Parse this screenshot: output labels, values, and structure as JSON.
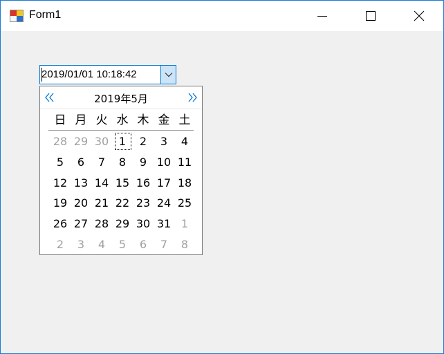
{
  "window": {
    "title": "Form1",
    "frame_color": "#1b7bd6",
    "icons": [
      "app-form-icon",
      "minimize-icon",
      "maximize-icon",
      "close-icon"
    ]
  },
  "date_picker": {
    "value": "2019/01/01 10:18:42",
    "dropdown_icon": "chevron-down-icon"
  },
  "calendar": {
    "title": "2019年5月",
    "prev_icon": "double-chevron-left-icon",
    "next_icon": "double-chevron-right-icon",
    "weekdays": [
      "日",
      "月",
      "火",
      "水",
      "木",
      "金",
      "土"
    ],
    "selected_day": "1",
    "weeks": [
      [
        {
          "d": "28",
          "o": true
        },
        {
          "d": "29",
          "o": true
        },
        {
          "d": "30",
          "o": true
        },
        {
          "d": "1",
          "o": false,
          "f": true
        },
        {
          "d": "2",
          "o": false
        },
        {
          "d": "3",
          "o": false
        },
        {
          "d": "4",
          "o": false
        }
      ],
      [
        {
          "d": "5",
          "o": false
        },
        {
          "d": "6",
          "o": false
        },
        {
          "d": "7",
          "o": false
        },
        {
          "d": "8",
          "o": false
        },
        {
          "d": "9",
          "o": false
        },
        {
          "d": "10",
          "o": false
        },
        {
          "d": "11",
          "o": false
        }
      ],
      [
        {
          "d": "12",
          "o": false
        },
        {
          "d": "13",
          "o": false
        },
        {
          "d": "14",
          "o": false
        },
        {
          "d": "15",
          "o": false
        },
        {
          "d": "16",
          "o": false
        },
        {
          "d": "17",
          "o": false
        },
        {
          "d": "18",
          "o": false
        }
      ],
      [
        {
          "d": "19",
          "o": false
        },
        {
          "d": "20",
          "o": false
        },
        {
          "d": "21",
          "o": false
        },
        {
          "d": "22",
          "o": false
        },
        {
          "d": "23",
          "o": false
        },
        {
          "d": "24",
          "o": false
        },
        {
          "d": "25",
          "o": false
        }
      ],
      [
        {
          "d": "26",
          "o": false
        },
        {
          "d": "27",
          "o": false
        },
        {
          "d": "28",
          "o": false
        },
        {
          "d": "29",
          "o": false
        },
        {
          "d": "30",
          "o": false
        },
        {
          "d": "31",
          "o": false
        },
        {
          "d": "1",
          "o": true
        }
      ],
      [
        {
          "d": "2",
          "o": true
        },
        {
          "d": "3",
          "o": true
        },
        {
          "d": "4",
          "o": true
        },
        {
          "d": "5",
          "o": true
        },
        {
          "d": "6",
          "o": true
        },
        {
          "d": "7",
          "o": true
        },
        {
          "d": "8",
          "o": true
        }
      ]
    ],
    "accent_color": "#0078d7",
    "other_month_color": "#a0a0a0"
  }
}
